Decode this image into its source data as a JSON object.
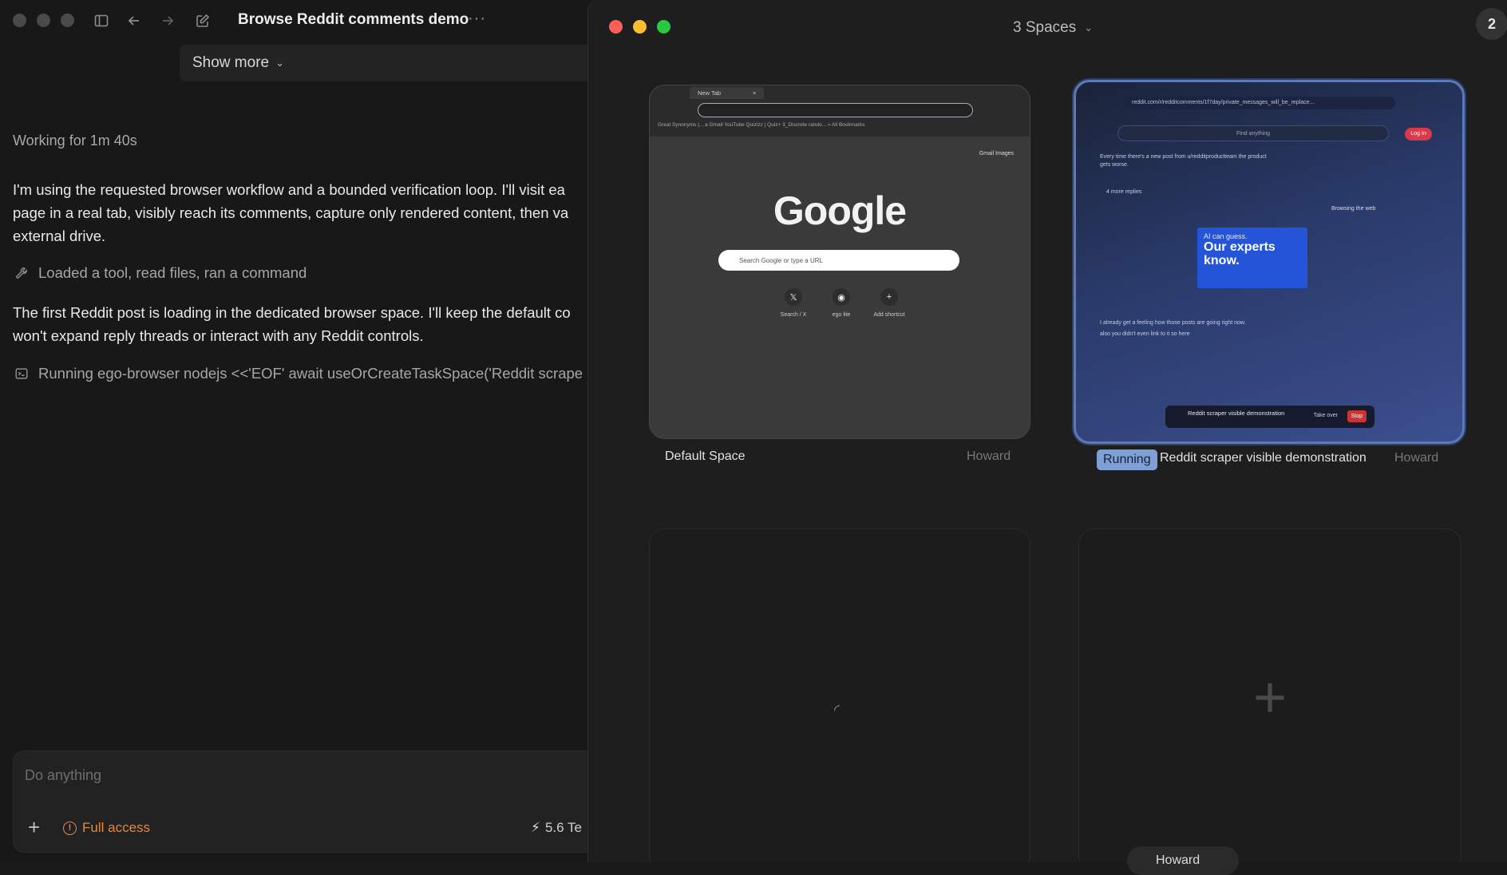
{
  "window": {
    "title": "Browse Reddit comments demo",
    "more_label": "···"
  },
  "thread": {
    "show_more": "Show more",
    "working": "Working for 1m 40s",
    "para1_line1": "I'm using the requested browser workflow and a bounded verification loop. I'll visit ea",
    "para1_line2": "page in a real tab, visibly reach its comments, capture only rendered content, then va",
    "para1_line3": "external drive.",
    "tool1": "Loaded a tool, read files, ran a command",
    "para2_line1": "The first Reddit post is loading in the dedicated browser space. I'll keep the default co",
    "para2_line2": "won't expand reply threads or interact with any Reddit controls.",
    "tool2": "Running ego-browser nodejs <<'EOF' await useOrCreateTaskSpace('Reddit scrape"
  },
  "composer": {
    "placeholder": "Do anything",
    "access_label": "Full access",
    "usage_label": "5.6 Te"
  },
  "spaces": {
    "title": "3 Spaces",
    "badge_count": "2",
    "default_space": {
      "name": "Default Space",
      "owner": "Howard",
      "tab_label": "New Tab",
      "bookmarks": "Great Synonyms |...   a   Gmail   YouTube   Quizizz | Quiz+   3_Discrete rando...   »   All Bookmarks",
      "top_links": "Gmail  Images",
      "logo_text": "Google",
      "search_placeholder": "Search Google or type a URL",
      "shortcuts": [
        "Search / X",
        "ego lite",
        "Add shortcut"
      ]
    },
    "reddit_space": {
      "status": "Running",
      "name": "Reddit scraper visible demonstration",
      "owner": "Howard",
      "url": "reddit.com/r/redditcomments/1f7day/private_messages_will_be_replace...",
      "search_placeholder": "Find anything",
      "login": "Log In",
      "line1": "Every time there's a new post from u/redditproductteam the product",
      "line2": "gets worse.",
      "replies": "4 more replies",
      "ad_small": "AI can guess.",
      "ad_big": "Our experts know.",
      "tooltip": "Browsing the web",
      "line3": "I already get a feeling how those posts are going right now.",
      "line4": "also you didn't even link to it so here",
      "bar_title": "Reddit scraper visible demonstration",
      "take_over": "Take over",
      "stop": "Stop"
    },
    "bottom_owner": "Howard"
  }
}
